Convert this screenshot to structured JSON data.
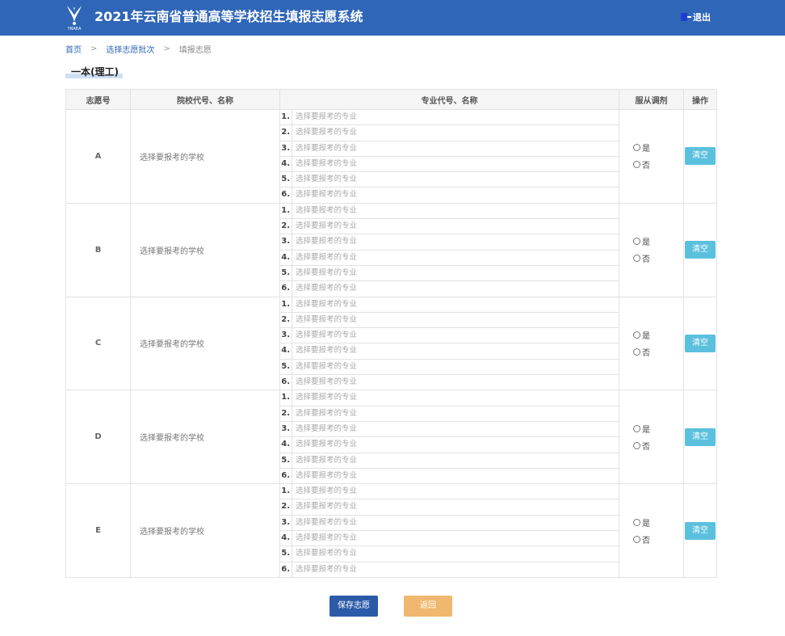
{
  "header": {
    "logo_text": "YNAEA",
    "title": "2021年云南省普通高等学校招生填报志愿系统",
    "logout_label": "退出",
    "logout_icon": "logout-icon"
  },
  "breadcrumb": {
    "items": [
      "首页",
      "选择志愿批次"
    ],
    "separator": ">",
    "current": "填报志愿"
  },
  "section": {
    "title": "一本(理工)"
  },
  "table": {
    "headers": [
      "志愿号",
      "院校代号、名称",
      "专业代号、名称",
      "服从调剂",
      "操作"
    ],
    "school_placeholder": "选择要报考的学校",
    "major_placeholder": "选择要报考的专业",
    "major_numbers": [
      "1.",
      "2.",
      "3.",
      "4.",
      "5.",
      "6."
    ],
    "radio_yes": "是",
    "radio_no": "否",
    "clear_label": "清空",
    "rows": [
      {
        "label": "A"
      },
      {
        "label": "B"
      },
      {
        "label": "C"
      },
      {
        "label": "D"
      },
      {
        "label": "E"
      }
    ]
  },
  "actions": {
    "save_label": "保存志愿",
    "back_label": "返回"
  },
  "colors": {
    "header_bg": "#2f66b8",
    "clear_btn": "#5bc0de",
    "save_btn": "#2b5ba8",
    "back_btn": "#f0b86e"
  }
}
